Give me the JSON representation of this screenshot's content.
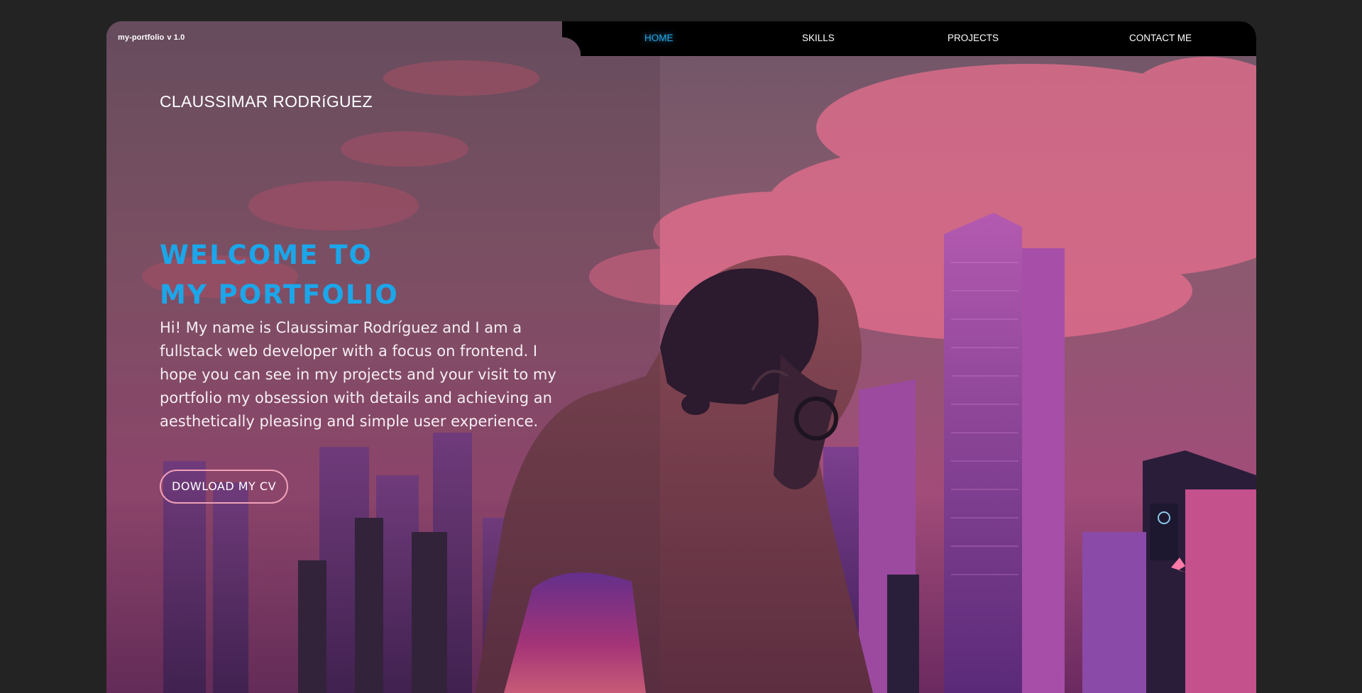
{
  "brand": {
    "name": "my-portfolio",
    "version": "v 1.0"
  },
  "nav": {
    "items": [
      {
        "label": "HOME",
        "active": true
      },
      {
        "label": "SKILLS",
        "active": false
      },
      {
        "label": "PROJECTS",
        "active": false
      },
      {
        "label": "CONTACT ME",
        "active": false
      }
    ]
  },
  "hero": {
    "name": "CLAUSSIMAR RODRíGUEZ",
    "welcome_line1": "WELCOME TO",
    "welcome_line2": "MY PORTFOLIO",
    "intro": "Hi! My name is Claussimar Rodríguez and I am a fullstack web developer with a focus on frontend. I hope you can see in my projects and your visit to my portfolio my obsession with details and achieving an aesthetically pleasing and simple user experience.",
    "cv_button": "DOWLOAD MY CV"
  },
  "colors": {
    "accent": "#1ca6ea",
    "page_background": "#232323",
    "nav_background": "#000000",
    "button_border": "#f0a0b8"
  }
}
